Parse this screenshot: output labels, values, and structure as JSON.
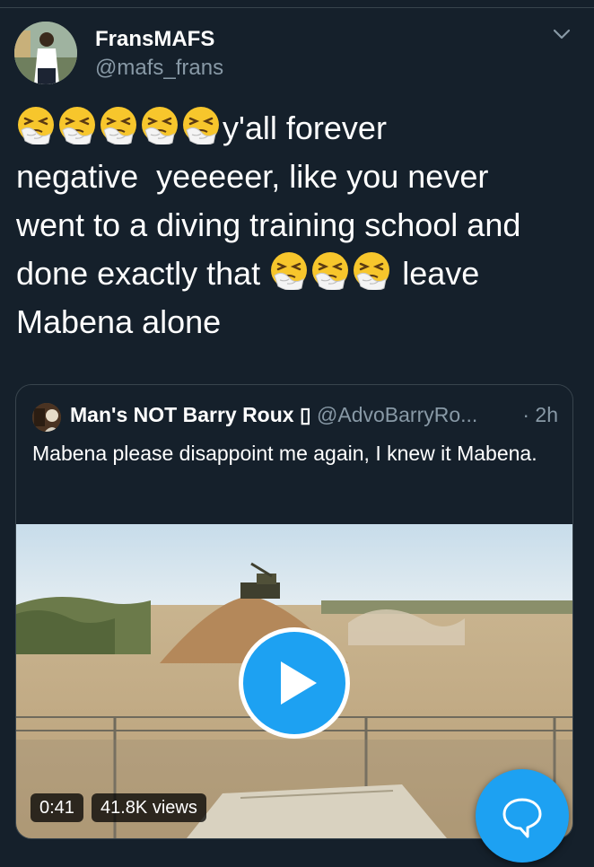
{
  "tweet": {
    "author_name": "FransMAFS",
    "author_handle": "@mafs_frans",
    "text_line_1": "y'all forever",
    "text_line_2": "negative  yeeeeer, like you never",
    "text_line_3": "went to a diving training school and",
    "text_line_4a": "done exactly that",
    "text_line_4b": "leave",
    "text_line_5": "Mabena alone",
    "emoji_icon": "sneezing-face-icon"
  },
  "quoted_tweet": {
    "author_name": "Man's NOT Barry Roux",
    "name_suffix": "▯",
    "author_handle": "@AdvoBarryRo...",
    "time": "· 2h",
    "text": "Mabena please disappoint me again, I knew it Mabena."
  },
  "video": {
    "duration": "0:41",
    "views": "41.8K views",
    "play_icon": "play-icon"
  },
  "actions": {
    "compose_icon": "compose-reply-icon"
  },
  "colors": {
    "background": "#15202b",
    "accent": "#1da1f2",
    "secondary_text": "#8899a6",
    "border": "#38444d"
  }
}
